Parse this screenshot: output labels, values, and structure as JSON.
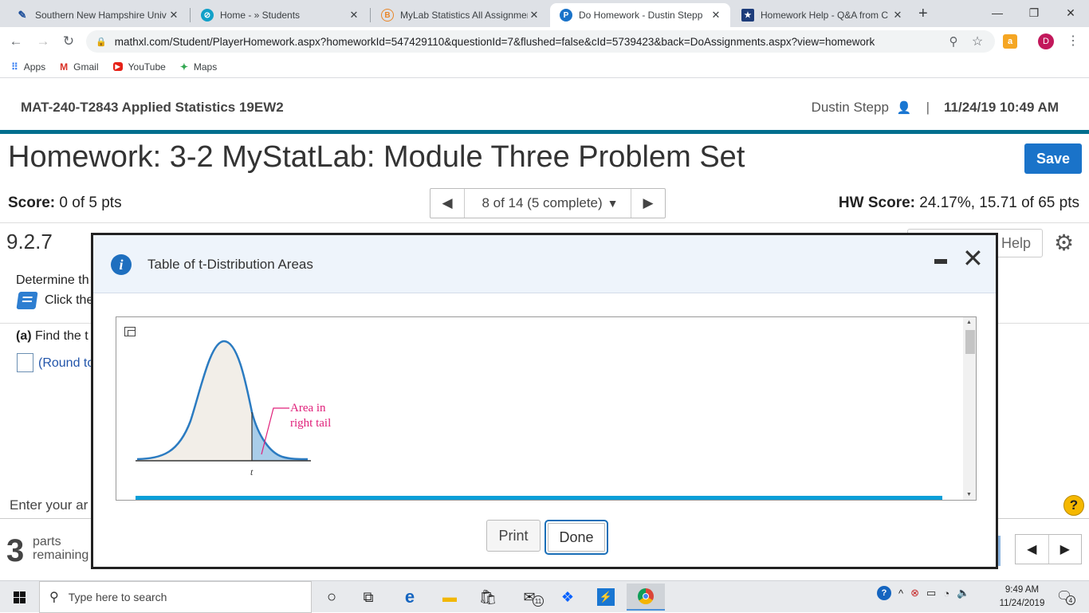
{
  "browser": {
    "tabs": [
      {
        "title": "Southern New Hampshire Univ",
        "icon": "snhu-icon",
        "color": "#1d4e9a"
      },
      {
        "title": "Home - » Students",
        "icon": "students-icon",
        "color": "#11a0c8"
      },
      {
        "title": "MyLab Statistics All Assignmen",
        "icon": "mylab-icon",
        "color": "#e8872a"
      },
      {
        "title": "Do Homework - Dustin Stepp",
        "icon": "pearson-icon",
        "color": "#1a73c9"
      },
      {
        "title": "Homework Help - Q&A from C",
        "icon": "chegg-icon",
        "color": "#1d3c7a"
      }
    ],
    "new_tab": "+",
    "window_controls": {
      "minimize": "—",
      "restore": "❐",
      "close": "✕"
    },
    "url": "mathxl.com/Student/PlayerHomework.aspx?homeworkId=547429110&questionId=7&flushed=false&cId=5739423&back=DoAssignments.aspx?view=homework",
    "profile_initial": "D",
    "bookmarks": [
      {
        "label": "Apps",
        "icon": "apps-icon"
      },
      {
        "label": "Gmail",
        "icon": "gmail-icon"
      },
      {
        "label": "YouTube",
        "icon": "youtube-icon"
      },
      {
        "label": "Maps",
        "icon": "maps-icon"
      }
    ]
  },
  "header": {
    "course": "MAT-240-T2843 Applied Statistics 19EW2",
    "user": "Dustin Stepp",
    "separator": "|",
    "datetime": "11/24/19 10:49 AM"
  },
  "homework": {
    "title": "Homework: 3-2 MyStatLab: Module Three Problem Set",
    "save_label": "Save",
    "score_label": "Score:",
    "score_value": "0 of 5 pts",
    "nav_position": "8 of 14 (5 complete)",
    "hw_score_label": "HW Score:",
    "hw_score_value": "24.17%, 15.71 of 65 pts",
    "question_number": "9.2.7",
    "help_label": "Help",
    "determine_text": "Determine th",
    "click_text": "Click the",
    "part_a_label": "(a)",
    "part_a_text": "Find the t",
    "round_note": "(Round to",
    "enter_answer": "Enter your ar",
    "parts_count": "3",
    "parts_label_1": "parts",
    "parts_label_2": "remaining"
  },
  "modal": {
    "title": "Table of t-Distribution Areas",
    "figure": {
      "annotation_line1": "Area in",
      "annotation_line2": "right tail",
      "axis_label": "t"
    },
    "print_label": "Print",
    "done_label": "Done"
  },
  "taskbar": {
    "search_placeholder": "Type here to search",
    "mail_badge": "11",
    "time": "9:49 AM",
    "date": "11/24/2019",
    "notification_count": "4"
  },
  "colors": {
    "header_bar": "#006f8e",
    "save_button": "#1a73c9",
    "curve": "#2b7bc1",
    "tail_fill": "#a9cde9",
    "body_fill": "#f2eee8",
    "annotation": "#e0207a",
    "table_bar": "#0a9fd8"
  }
}
